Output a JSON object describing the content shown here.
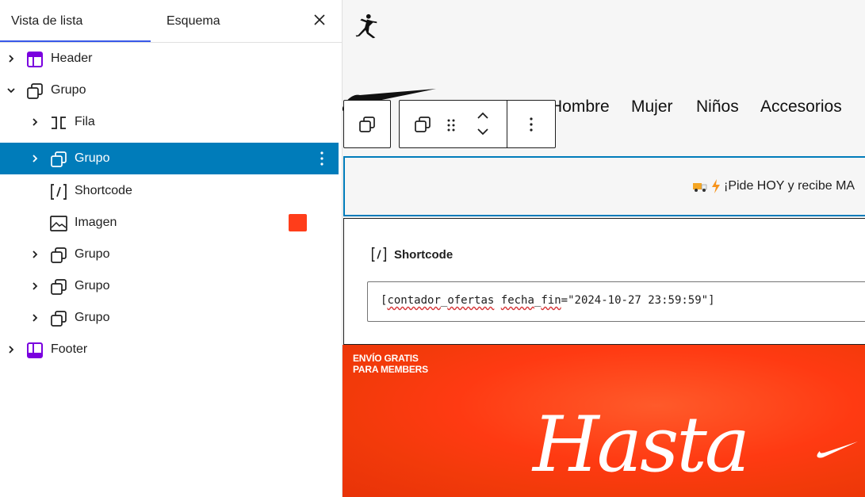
{
  "sidebar": {
    "tabs": [
      {
        "label": "Vista de lista"
      },
      {
        "label": "Esquema"
      }
    ],
    "tree": [
      {
        "label": "Header"
      },
      {
        "label": "Grupo"
      },
      {
        "label": "Fila"
      },
      {
        "label": "Grupo"
      },
      {
        "label": "Shortcode"
      },
      {
        "label": "Imagen"
      },
      {
        "label": "Grupo"
      },
      {
        "label": "Grupo"
      },
      {
        "label": "Grupo"
      },
      {
        "label": "Footer"
      }
    ],
    "selected_index": 3,
    "accent": "#007cba",
    "template_part_color": "#7a00df",
    "image_swatch_color": "#ff3d1a"
  },
  "canvas": {
    "nav": [
      "Hombre",
      "Mujer",
      "Niños",
      "Accesorios"
    ],
    "banner_text": "¡Pide HOY y recibe MA",
    "shortcode": {
      "label": "Shortcode",
      "value_prefix": "[",
      "value_word1": "contador",
      "value_sep1": "_",
      "value_word2": "ofertas",
      "value_space1": " ",
      "value_word3": "fecha",
      "value_sep2": "_",
      "value_word4": "fin",
      "value_rest": "=\"2024-10-27 23:59:59\"]"
    },
    "hero": {
      "line1": "ENVÍO GRATIS",
      "line2": "PARA MEMBERS",
      "headline": "Hasta"
    }
  }
}
